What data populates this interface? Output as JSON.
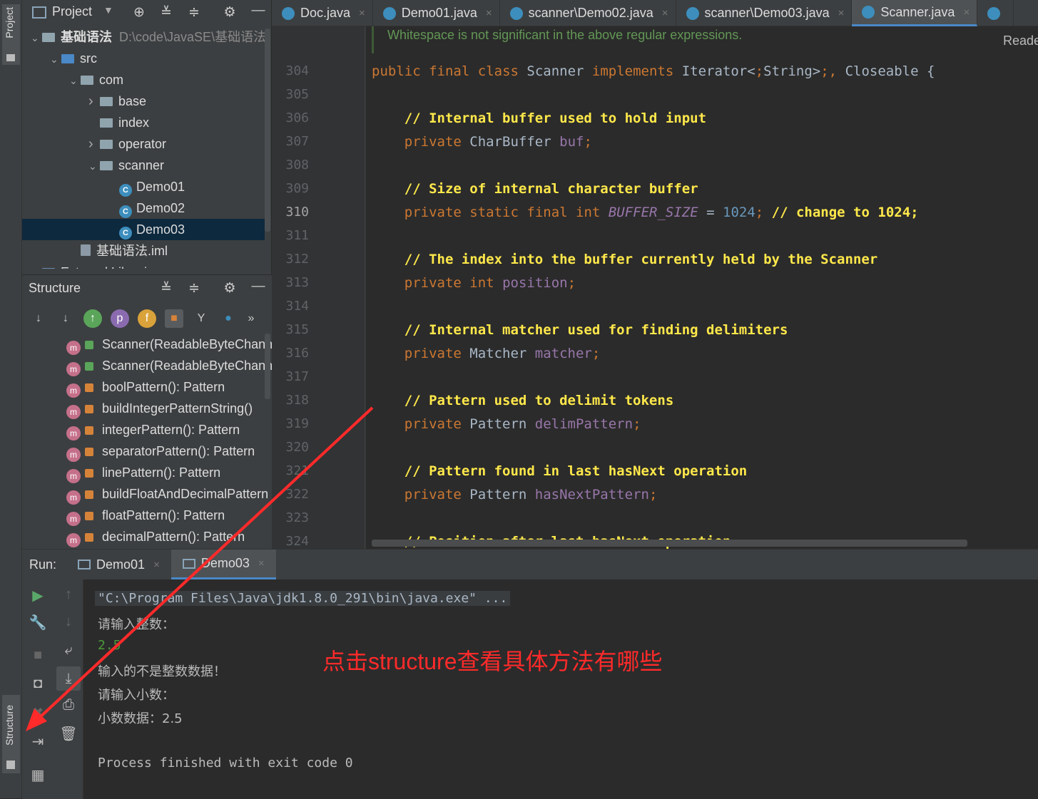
{
  "left_strip": {
    "project_label": "Project",
    "structure_label": "Structure"
  },
  "project": {
    "title": "Project",
    "tree": [
      {
        "label": "基础语法",
        "path": "D:\\code\\JavaSE\\基础语法",
        "depth": 0,
        "kind": "module",
        "arrow": "v"
      },
      {
        "label": "src",
        "depth": 1,
        "kind": "src",
        "arrow": "v"
      },
      {
        "label": "com",
        "depth": 2,
        "kind": "package",
        "arrow": "v"
      },
      {
        "label": "base",
        "depth": 3,
        "kind": "package",
        "arrow": ">"
      },
      {
        "label": "index",
        "depth": 3,
        "kind": "package",
        "arrow": ""
      },
      {
        "label": "operator",
        "depth": 3,
        "kind": "package",
        "arrow": ">"
      },
      {
        "label": "scanner",
        "depth": 3,
        "kind": "package",
        "arrow": "v"
      },
      {
        "label": "Demo01",
        "depth": 4,
        "kind": "class",
        "arrow": ""
      },
      {
        "label": "Demo02",
        "depth": 4,
        "kind": "class",
        "arrow": ""
      },
      {
        "label": "Demo03",
        "depth": 4,
        "kind": "class",
        "arrow": "",
        "selected": true
      },
      {
        "label": "基础语法.iml",
        "depth": 2,
        "kind": "iml",
        "arrow": ""
      },
      {
        "label": "External Libraries",
        "depth": 0,
        "kind": "lib",
        "arrow": ">"
      }
    ]
  },
  "structure": {
    "title": "Structure",
    "items": [
      {
        "label": "Scanner(ReadableByteChannel",
        "vis": "public"
      },
      {
        "label": "Scanner(ReadableByteChannel",
        "vis": "public"
      },
      {
        "label": "boolPattern(): Pattern",
        "vis": "private"
      },
      {
        "label": "buildIntegerPatternString()",
        "vis": "private"
      },
      {
        "label": "integerPattern(): Pattern",
        "vis": "private"
      },
      {
        "label": "separatorPattern(): Pattern",
        "vis": "private"
      },
      {
        "label": "linePattern(): Pattern",
        "vis": "private"
      },
      {
        "label": "buildFloatAndDecimalPattern",
        "vis": "private"
      },
      {
        "label": "floatPattern(): Pattern",
        "vis": "private"
      },
      {
        "label": "decimalPattern(): Pattern",
        "vis": "private"
      }
    ]
  },
  "tabs": [
    {
      "label": "Doc.java",
      "active": false
    },
    {
      "label": "Demo01.java",
      "active": false
    },
    {
      "label": "scanner\\Demo02.java",
      "active": false
    },
    {
      "label": "scanner\\Demo03.java",
      "active": false
    },
    {
      "label": "Scanner.java",
      "active": true
    }
  ],
  "editor": {
    "reader_mode": "Reader Mode",
    "doc_comment": "Whitespace is not significant in the above regular expressions.",
    "current_line": 310,
    "lines": [
      {
        "n": 304,
        "code": "public final class Scanner implements Iterator<String>, Closeable {"
      },
      {
        "n": 305,
        "code": ""
      },
      {
        "n": 306,
        "code": "    // Internal buffer used to hold input"
      },
      {
        "n": 307,
        "code": "    private CharBuffer buf;"
      },
      {
        "n": 308,
        "code": ""
      },
      {
        "n": 309,
        "code": "    // Size of internal character buffer"
      },
      {
        "n": 310,
        "code": "    private static final int BUFFER_SIZE = 1024; // change to 1024;"
      },
      {
        "n": 311,
        "code": ""
      },
      {
        "n": 312,
        "code": "    // The index into the buffer currently held by the Scanner"
      },
      {
        "n": 313,
        "code": "    private int position;"
      },
      {
        "n": 314,
        "code": ""
      },
      {
        "n": 315,
        "code": "    // Internal matcher used for finding delimiters"
      },
      {
        "n": 316,
        "code": "    private Matcher matcher;"
      },
      {
        "n": 317,
        "code": ""
      },
      {
        "n": 318,
        "code": "    // Pattern used to delimit tokens"
      },
      {
        "n": 319,
        "code": "    private Pattern delimPattern;"
      },
      {
        "n": 320,
        "code": ""
      },
      {
        "n": 321,
        "code": "    // Pattern found in last hasNext operation"
      },
      {
        "n": 322,
        "code": "    private Pattern hasNextPattern;"
      },
      {
        "n": 323,
        "code": ""
      },
      {
        "n": 324,
        "code": "    // Position after last hasNext operation"
      }
    ]
  },
  "run": {
    "label": "Run:",
    "tabs": [
      {
        "label": "Demo01",
        "active": false
      },
      {
        "label": "Demo03",
        "active": true
      }
    ],
    "console": [
      {
        "text": "\"C:\\Program Files\\Java\\jdk1.8.0_291\\bin\\java.exe\" ...",
        "kind": "cmd"
      },
      {
        "text": "请输入整数：",
        "kind": "out"
      },
      {
        "text": "2.5",
        "kind": "input"
      },
      {
        "text": "输入的不是整数数据！",
        "kind": "out"
      },
      {
        "text": "请输入小数：",
        "kind": "out"
      },
      {
        "text": "小数数据：2.5",
        "kind": "out"
      },
      {
        "text": "",
        "kind": "out"
      },
      {
        "text": "Process finished with exit code 0",
        "kind": "out"
      }
    ]
  },
  "annotation": {
    "text": "点击structure查看具体方法有哪些",
    "color": "#ff2a2a"
  },
  "colors": {
    "keyword": "#cc7832",
    "comment": "#ffe84a",
    "number": "#6897bb",
    "field": "#9876aa",
    "accent": "#4a88c7",
    "selection": "#0d293e"
  }
}
